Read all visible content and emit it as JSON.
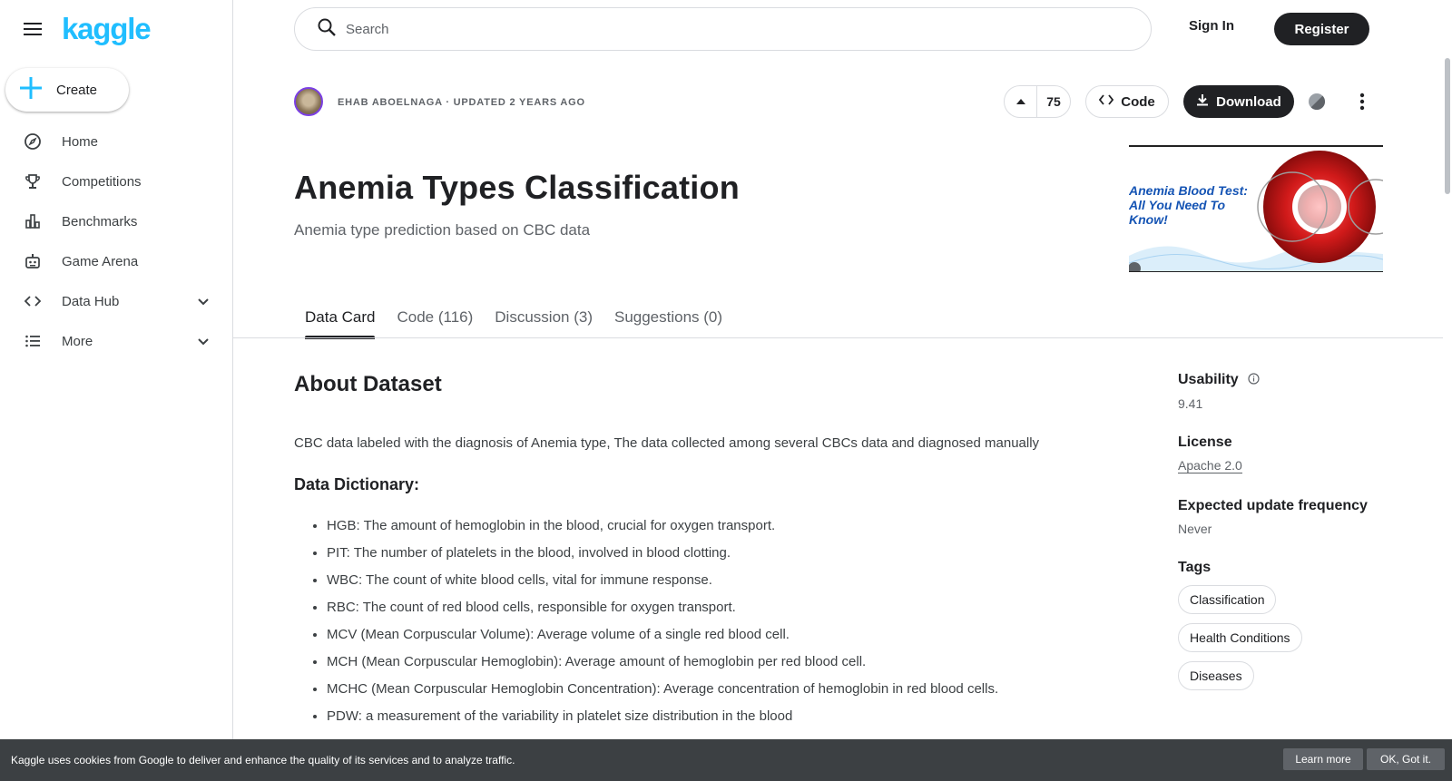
{
  "brand": {
    "logo_text": "kaggle",
    "accent": "#20beff"
  },
  "sidebar": {
    "create_label": "Create",
    "items": [
      {
        "label": "Home",
        "icon": "compass-icon"
      },
      {
        "label": "Competitions",
        "icon": "trophy-icon"
      },
      {
        "label": "Benchmarks",
        "icon": "bar-chart-icon"
      },
      {
        "label": "Game Arena",
        "icon": "robot-icon"
      },
      {
        "label": "Data Hub",
        "icon": "code-brackets-icon",
        "expandable": true
      },
      {
        "label": "More",
        "icon": "list-icon",
        "expandable": true
      }
    ]
  },
  "header": {
    "search_placeholder": "Search",
    "sign_in": "Sign In",
    "register": "Register"
  },
  "dataset": {
    "byline": "EHAB ABOELNAGA · UPDATED 2 YEARS AGO",
    "upvotes": "75",
    "code_label": "Code",
    "download_label": "Download",
    "title": "Anemia Types Classification",
    "subtitle": "Anemia type prediction based on CBC data",
    "banner_text": "Anemia Blood Test: All You Need To Know!"
  },
  "tabs": [
    {
      "label": "Data Card",
      "active": true
    },
    {
      "label": "Code (116)"
    },
    {
      "label": "Discussion (3)"
    },
    {
      "label": "Suggestions (0)"
    }
  ],
  "about": {
    "heading": "About Dataset",
    "description": "CBC data labeled with the diagnosis of Anemia type, The data collected among several CBCs data and diagnosed manually",
    "dict_heading": "Data Dictionary:",
    "dict_items": [
      "HGB: The amount of hemoglobin in the blood, crucial for oxygen transport.",
      "PIT: The number of platelets in the blood, involved in blood clotting.",
      "WBC: The count of white blood cells, vital for immune response.",
      "RBC: The count of red blood cells, responsible for oxygen transport.",
      "MCV (Mean Corpuscular Volume): Average volume of a single red blood cell.",
      "MCH (Mean Corpuscular Hemoglobin): Average amount of hemoglobin per red blood cell.",
      "MCHC (Mean Corpuscular Hemoglobin Concentration): Average concentration of hemoglobin in red blood cells.",
      "PDW: a measurement of the variability in platelet size distribution in the blood"
    ]
  },
  "meta": {
    "usability_label": "Usability",
    "usability_value": "9.41",
    "license_label": "License",
    "license_value": "Apache 2.0",
    "frequency_label": "Expected update frequency",
    "frequency_value": "Never",
    "tags_label": "Tags",
    "tags": [
      "Classification",
      "Health Conditions",
      "Diseases"
    ]
  },
  "cookie": {
    "message": "Kaggle uses cookies from Google to deliver and enhance the quality of its services and to analyze traffic.",
    "learn_more": "Learn more",
    "ok": "OK, Got it."
  }
}
